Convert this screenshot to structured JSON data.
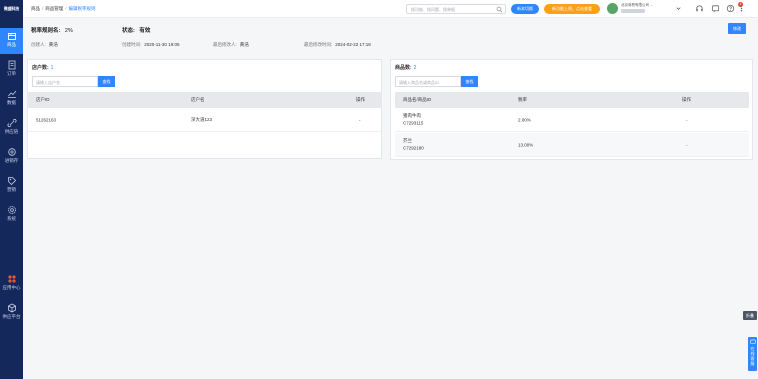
{
  "sidebar": {
    "logo": "微盛科技",
    "items": [
      {
        "label": "商品",
        "icon": "box-icon"
      },
      {
        "label": "订单",
        "icon": "document-icon"
      },
      {
        "label": "数据",
        "icon": "chart-icon"
      },
      {
        "label": "供应链",
        "icon": "link-icon"
      },
      {
        "label": "进销存",
        "icon": "refresh-icon"
      },
      {
        "label": "营销",
        "icon": "tag-icon"
      },
      {
        "label": "系统",
        "icon": "gear-icon"
      },
      {
        "label": "应用中心",
        "icon": "apps-icon"
      },
      {
        "label": "供应平台",
        "icon": "cube-icon"
      }
    ]
  },
  "topbar": {
    "breadcrumb": [
      "商品",
      "商品管理",
      "编辑税率规则"
    ],
    "search_placeholder": "搜功能、搜问题、搜单据",
    "btn_new_version": "新本切换",
    "btn_promo": "新功能上线，点击查看",
    "user_name": "北京商贸有限公司 ...",
    "badge": "3"
  },
  "rule": {
    "name_label": "税率规则名:",
    "name_value": "2%",
    "status_label": "状态:",
    "status_value": "有效",
    "creator_label": "创建人:",
    "creator_value": "黄浩",
    "created_label": "创建时间:",
    "created_value": "2020-11-30 19:05",
    "modifier_label": "最后修改人:",
    "modifier_value": "黄浩",
    "modified_label": "最后修改时间:",
    "modified_value": "2024-02-22 17:18",
    "edit_label": "修改"
  },
  "shops": {
    "count_label": "店户数:",
    "count_value": "1",
    "search_placeholder": "请输入店户名",
    "search_btn": "查找",
    "columns": [
      "店户ID",
      "店户名",
      "操作"
    ],
    "rows": [
      {
        "id": "51262163",
        "name": "深大道123",
        "action": "-"
      }
    ]
  },
  "goods": {
    "count_label": "商品数:",
    "count_value": "2",
    "search_placeholder": "请输入商品名或商品ID",
    "search_btn": "查找",
    "columns": [
      "商品名/商品ID",
      "税率",
      "操作"
    ],
    "rows": [
      {
        "name": "猪肉牛肉",
        "id": "C7293115",
        "rate": "2.00%",
        "action": "-"
      },
      {
        "name": "芥兰",
        "id": "C7292180",
        "rate": "13.00%",
        "action": "-"
      }
    ]
  },
  "float": {
    "tab": "折叠",
    "help": "在线客服"
  },
  "colors": {
    "sidebar": "#14285c",
    "accent": "#2f86ff",
    "promo": "#ff9f1a"
  }
}
